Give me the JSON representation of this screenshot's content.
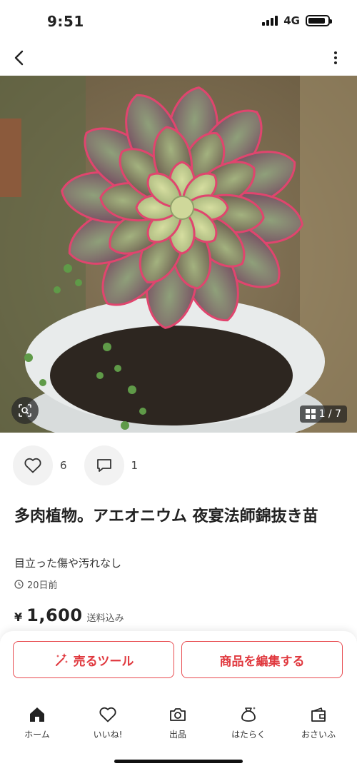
{
  "status_bar": {
    "time": "9:51",
    "network": "4G",
    "battery_level": 0.9
  },
  "photo": {
    "counter": "1 / 7"
  },
  "reactions": {
    "likes": "6",
    "comments": "1"
  },
  "item": {
    "title": "多肉植物。アエオニウム 夜宴法師錦抜き苗",
    "condition": "目立った傷や汚れなし",
    "posted": "20日前",
    "price_symbol": "¥",
    "price": "1,600",
    "shipping": "送料込み"
  },
  "actions": {
    "sell_tool": "売るツール",
    "edit_item": "商品を編集する"
  },
  "tabs": [
    {
      "label": "ホーム",
      "icon": "home-icon"
    },
    {
      "label": "いいね!",
      "icon": "heart-icon"
    },
    {
      "label": "出品",
      "icon": "camera-icon"
    },
    {
      "label": "はたらく",
      "icon": "money-bag-icon"
    },
    {
      "label": "おさいふ",
      "icon": "wallet-icon"
    }
  ],
  "colors": {
    "accent": "#e0383e",
    "text": "#222222",
    "muted": "#555555"
  }
}
